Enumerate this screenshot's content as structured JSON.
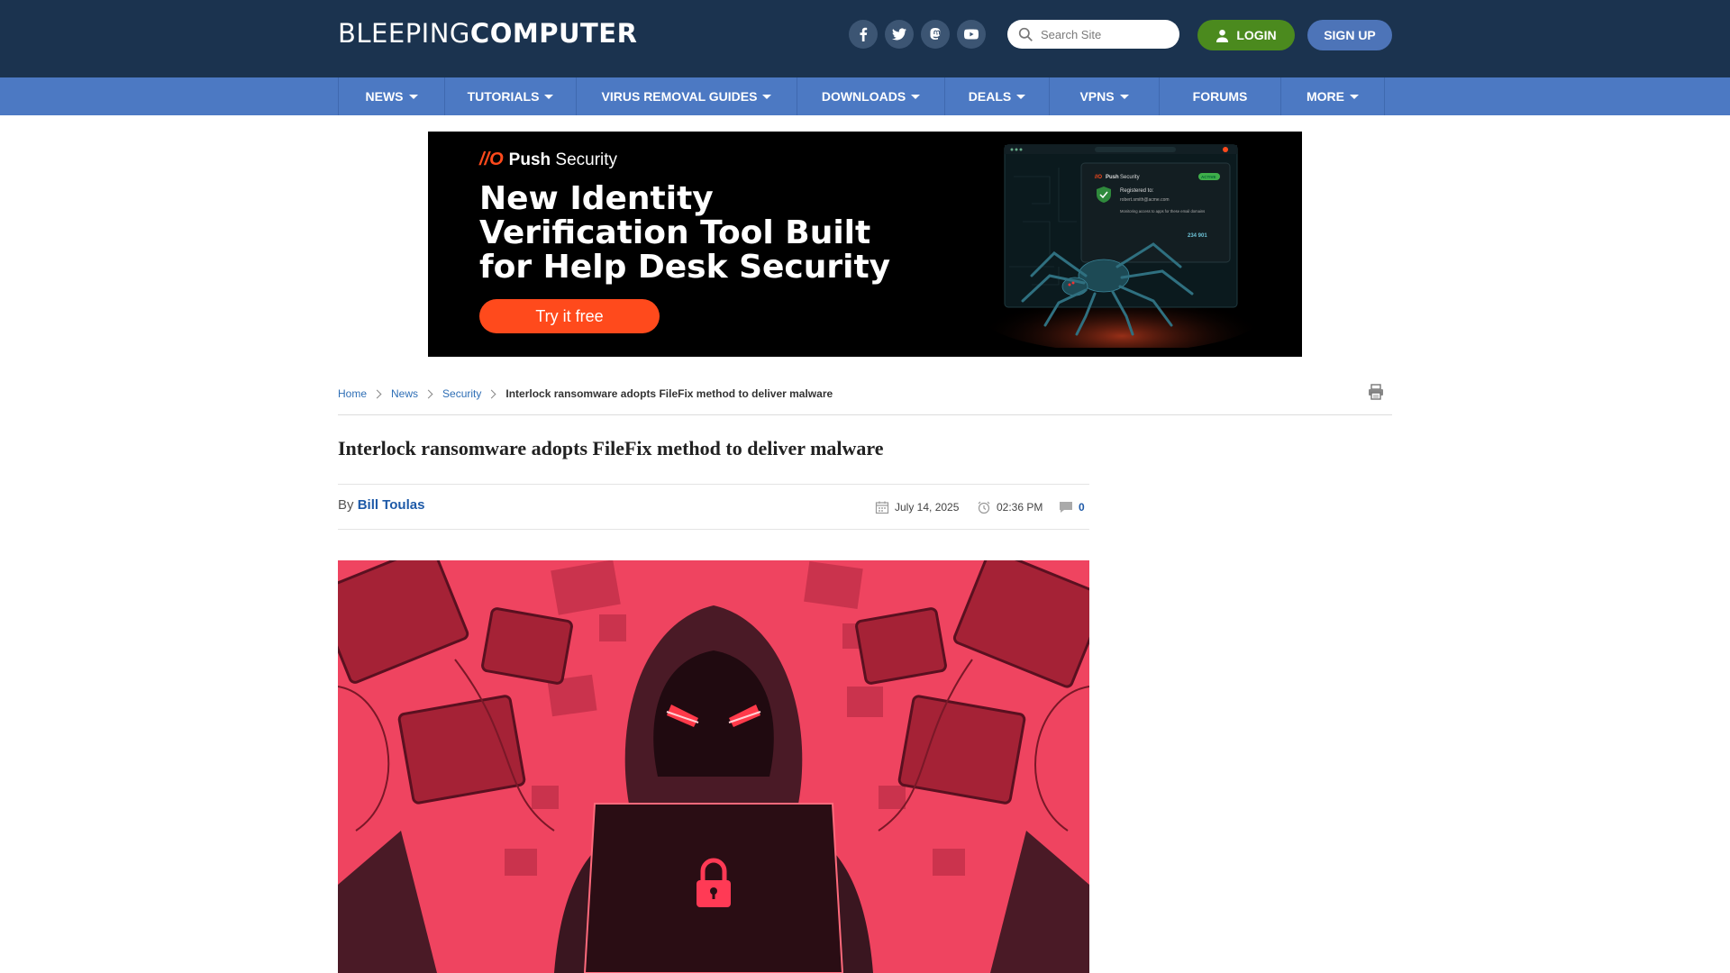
{
  "header": {
    "logo_part1": "BLEEPING",
    "logo_part2": "COMPUTER",
    "social": [
      "facebook-icon",
      "twitter-icon",
      "mastodon-icon",
      "youtube-icon"
    ],
    "search_placeholder": "Search Site",
    "login_label": "LOGIN",
    "signup_label": "SIGN UP"
  },
  "nav": {
    "items": [
      {
        "label": "NEWS",
        "dropdown": true
      },
      {
        "label": "TUTORIALS",
        "dropdown": true
      },
      {
        "label": "VIRUS REMOVAL GUIDES",
        "dropdown": true
      },
      {
        "label": "DOWNLOADS",
        "dropdown": true
      },
      {
        "label": "DEALS",
        "dropdown": true
      },
      {
        "label": "VPNS",
        "dropdown": true
      },
      {
        "label": "FORUMS",
        "dropdown": false
      },
      {
        "label": "MORE",
        "dropdown": true
      }
    ]
  },
  "ad": {
    "brand_mark": "//O",
    "brand_bold": "Push",
    "brand_rest": "Security",
    "headline": "New Identity Verification Tool Built for Help Desk Security",
    "cta": "Try it free",
    "mock_registered": "Registered to:",
    "mock_email": "robert.smith@acme.com",
    "mock_note": "Monitoring access to apps for these email domains",
    "mock_count": "234 901",
    "mock_badge": "ACTIVE"
  },
  "breadcrumb": {
    "home": "Home",
    "news": "News",
    "security": "Security",
    "current": "Interlock ransomware adopts FileFix method to deliver malware"
  },
  "article": {
    "title": "Interlock ransomware adopts FileFix method to deliver malware",
    "by": "By",
    "author": "Bill Toulas",
    "date": "July 14, 2025",
    "time": "02:36 PM",
    "comments": "0"
  },
  "colors": {
    "header_bg": "#1b334f",
    "nav_bg": "#4c79c3",
    "login_bg": "#4b8a1e",
    "signup_bg": "#4d74b8",
    "ad_accent": "#ff4a1c",
    "link": "#2e6eb5"
  }
}
